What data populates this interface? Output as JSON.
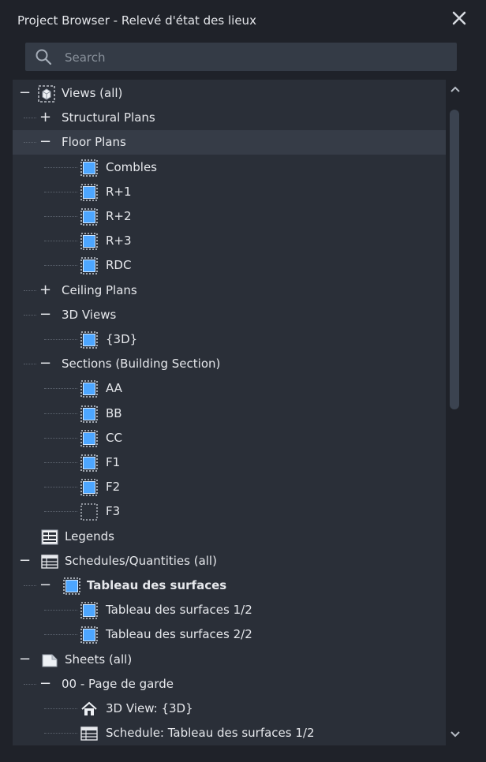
{
  "window": {
    "title": "Project Browser - Relevé d'état des lieux",
    "close_icon": "close-icon"
  },
  "search": {
    "placeholder": "Search",
    "value": ""
  },
  "colors": {
    "background": "#1f2229",
    "tree_bg": "#2a2f38",
    "view_icon_blue": "#4da6ff",
    "selected_row": "#363c47"
  },
  "tree": [
    {
      "label": "Views (all)",
      "toggle": "−",
      "icon": "browser-views-icon",
      "bold": false
    },
    {
      "label": "Structural Plans",
      "toggle": "+",
      "icon": "",
      "bold": false
    },
    {
      "label": "Floor Plans",
      "toggle": "−",
      "icon": "",
      "bold": false,
      "selected": true
    },
    {
      "label": "Combles",
      "toggle": "",
      "icon": "view-icon",
      "bold": false
    },
    {
      "label": "R+1",
      "toggle": "",
      "icon": "view-icon",
      "bold": false
    },
    {
      "label": "R+2",
      "toggle": "",
      "icon": "view-icon",
      "bold": false
    },
    {
      "label": "R+3",
      "toggle": "",
      "icon": "view-icon",
      "bold": false
    },
    {
      "label": "RDC",
      "toggle": "",
      "icon": "view-icon",
      "bold": false
    },
    {
      "label": "Ceiling Plans",
      "toggle": "+",
      "icon": "",
      "bold": false
    },
    {
      "label": "3D Views",
      "toggle": "−",
      "icon": "",
      "bold": false
    },
    {
      "label": "{3D}",
      "toggle": "",
      "icon": "view-icon",
      "bold": false
    },
    {
      "label": "Sections (Building Section)",
      "toggle": "−",
      "icon": "",
      "bold": false
    },
    {
      "label": "AA",
      "toggle": "",
      "icon": "view-icon",
      "bold": false
    },
    {
      "label": "BB",
      "toggle": "",
      "icon": "view-icon",
      "bold": false
    },
    {
      "label": "CC",
      "toggle": "",
      "icon": "view-icon",
      "bold": false
    },
    {
      "label": "F1",
      "toggle": "",
      "icon": "view-icon",
      "bold": false
    },
    {
      "label": "F2",
      "toggle": "",
      "icon": "view-icon",
      "bold": false
    },
    {
      "label": "F3",
      "toggle": "",
      "icon": "view-empty-icon",
      "bold": false
    },
    {
      "label": "Legends",
      "toggle": "",
      "icon": "legend-icon",
      "bold": false
    },
    {
      "label": "Schedules/Quantities (all)",
      "toggle": "−",
      "icon": "schedule-icon",
      "bold": false
    },
    {
      "label": "Tableau des surfaces",
      "toggle": "−",
      "icon": "view-icon",
      "bold": true
    },
    {
      "label": "Tableau des surfaces 1/2",
      "toggle": "",
      "icon": "view-icon",
      "bold": false
    },
    {
      "label": "Tableau des surfaces 2/2",
      "toggle": "",
      "icon": "view-icon",
      "bold": false
    },
    {
      "label": "Sheets (all)",
      "toggle": "−",
      "icon": "sheet-icon",
      "bold": false
    },
    {
      "label": "00 - Page de garde",
      "toggle": "−",
      "icon": "",
      "bold": false
    },
    {
      "label": "3D View: {3D}",
      "toggle": "",
      "icon": "house-icon",
      "bold": false
    },
    {
      "label": "Schedule: Tableau des surfaces 1/2",
      "toggle": "",
      "icon": "schedule-icon",
      "bold": false
    }
  ]
}
